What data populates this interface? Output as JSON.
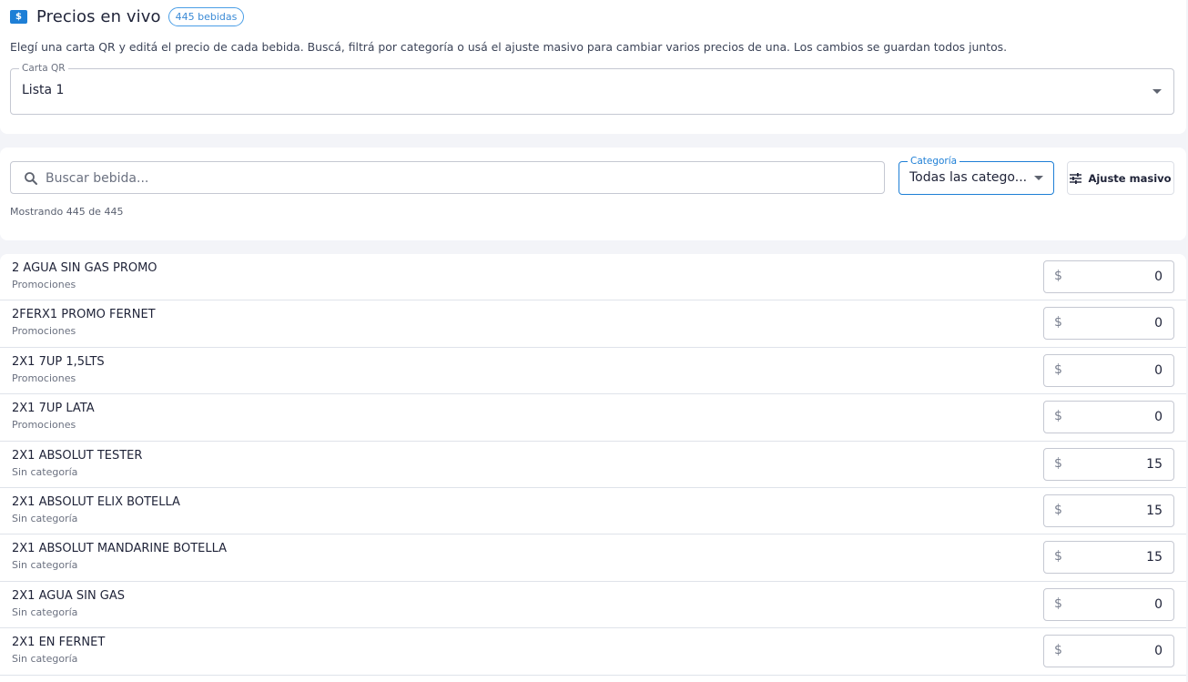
{
  "header": {
    "title": "Precios en vivo",
    "badge": "445 bebidas",
    "icon": "money-icon",
    "help_text": "Elegí una carta QR y editá el precio de cada bebida. Buscá, filtrá por categoría o usá el ajuste masivo para cambiar varios precios de una. Los cambios se guardan todos juntos."
  },
  "carta": {
    "label": "Carta QR",
    "value": "Lista 1"
  },
  "filters": {
    "search_placeholder": "Buscar bebida...",
    "category_label": "Categoría",
    "category_value": "Todas las catego...",
    "bulk_label": "Ajuste masivo",
    "showing": "Mostrando 445 de 445"
  },
  "currency_symbol": "$",
  "accent_color": "#1e7fd6",
  "items": [
    {
      "name": "2 AGUA SIN GAS PROMO",
      "category": "Promociones",
      "price": "0"
    },
    {
      "name": "2FERX1 PROMO FERNET",
      "category": "Promociones",
      "price": "0"
    },
    {
      "name": "2X1 7UP 1,5LTS",
      "category": "Promociones",
      "price": "0"
    },
    {
      "name": "2X1 7UP LATA",
      "category": "Promociones",
      "price": "0"
    },
    {
      "name": "2X1 ABSOLUT TESTER",
      "category": "Sin categoría",
      "price": "15"
    },
    {
      "name": "2X1 ABSOLUT ELIX BOTELLA",
      "category": "Sin categoría",
      "price": "15"
    },
    {
      "name": "2X1 ABSOLUT MANDARINE BOTELLA",
      "category": "Sin categoría",
      "price": "15"
    },
    {
      "name": "2X1 AGUA SIN GAS",
      "category": "Sin categoría",
      "price": "0"
    },
    {
      "name": "2X1 EN FERNET",
      "category": "Sin categoría",
      "price": "0"
    }
  ]
}
